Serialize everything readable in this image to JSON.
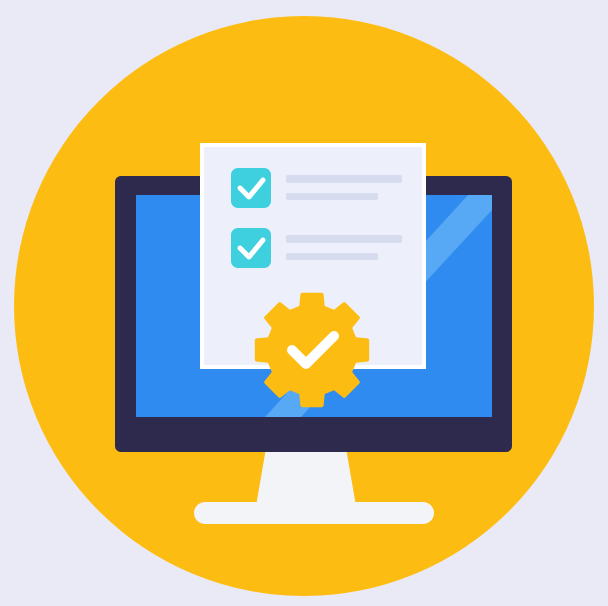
{
  "illustration": {
    "subject": "computer-checklist-settings-icon",
    "icons": [
      "monitor-icon",
      "checklist-document-icon",
      "checkbox-checked-icon",
      "gear-check-icon"
    ],
    "checklist_items": [
      {
        "checked": true
      },
      {
        "checked": true
      }
    ]
  },
  "colors": {
    "background": "#e9eaf6",
    "circle": "#fdbc12",
    "monitor_frame": "#2d2a4e",
    "screen": "#2f8bf0",
    "screen_highlight": "#57a8f5",
    "stand": "#f3f4f8",
    "document": "#edf0fa",
    "document_border": "#ffffff",
    "line_placeholder": "#d6dbee",
    "checkbox": "#3fd0e0",
    "check_mark": "#ffffff",
    "gear": "#fdbc12"
  }
}
